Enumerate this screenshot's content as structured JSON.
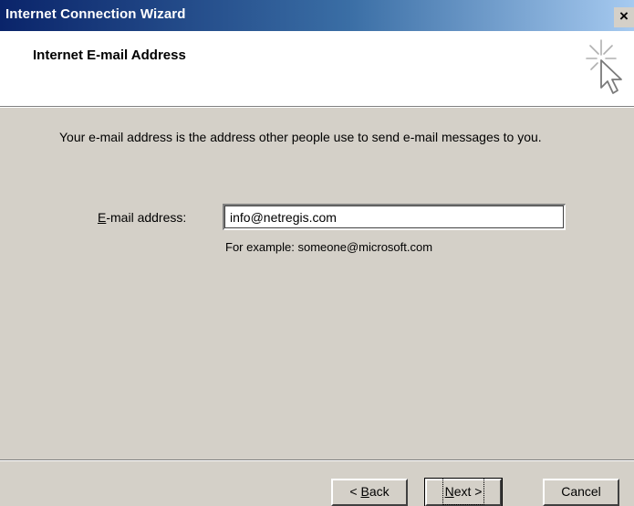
{
  "window": {
    "title": "Internet Connection Wizard",
    "close_label": "×"
  },
  "header": {
    "title": "Internet E-mail Address",
    "icon": "wizard-cursor-sparkle"
  },
  "body": {
    "description": "Your e-mail address is the address other people use to send e-mail messages to you.",
    "email_label_prefix": "E",
    "email_label_rest": "-mail address:",
    "email_value": "info@netregis.com",
    "example": "For example: someone@microsoft.com"
  },
  "buttons": {
    "back_prefix": "< ",
    "back_underline": "B",
    "back_rest": "ack",
    "next_underline": "N",
    "next_rest": "ext >",
    "cancel": "Cancel"
  }
}
